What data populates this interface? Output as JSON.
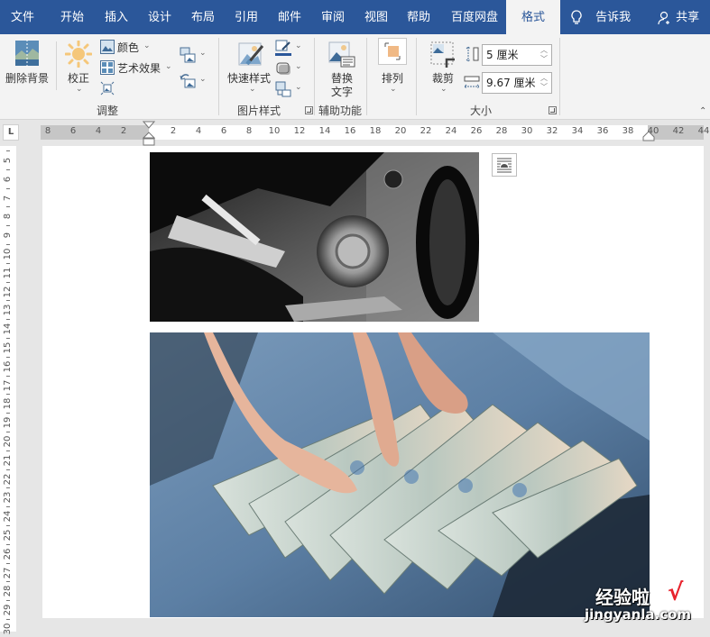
{
  "tabs": [
    {
      "label": "文件"
    },
    {
      "label": "开始"
    },
    {
      "label": "插入"
    },
    {
      "label": "设计"
    },
    {
      "label": "布局"
    },
    {
      "label": "引用"
    },
    {
      "label": "邮件"
    },
    {
      "label": "审阅"
    },
    {
      "label": "视图"
    },
    {
      "label": "帮助"
    },
    {
      "label": "百度网盘"
    },
    {
      "label": "格式",
      "active": true
    }
  ],
  "tell_me": "告诉我",
  "share": "共享",
  "ribbon": {
    "adjust": {
      "remove_bg": "删除背景",
      "corrections": "校正",
      "color": "颜色",
      "artistic": "艺术效果",
      "group_label": "调整"
    },
    "picture_styles": {
      "quick_styles": "快速样式",
      "group_label": "图片样式"
    },
    "accessibility": {
      "alt_text_line1": "替换",
      "alt_text_line2": "文字",
      "group_label": "辅助功能"
    },
    "arrange": {
      "label": "排列"
    },
    "size": {
      "crop": "裁剪",
      "height_value": "5 厘米",
      "width_value": "9.67 厘米",
      "group_label": "大小"
    }
  },
  "ruler": {
    "tab_selector": "L",
    "h_left": [
      "8",
      "6",
      "4",
      "2"
    ],
    "h_right": [
      "2",
      "4",
      "6",
      "8",
      "10",
      "12",
      "14",
      "16",
      "18",
      "20",
      "22",
      "24",
      "26",
      "28",
      "30",
      "32",
      "34",
      "36",
      "38",
      "40",
      "42",
      "44"
    ],
    "v": [
      "5",
      "6",
      "7",
      "8",
      "9",
      "10",
      "11",
      "12",
      "13",
      "14",
      "15",
      "16",
      "17",
      "18",
      "19",
      "20",
      "21",
      "22",
      "23",
      "24",
      "25",
      "26",
      "27",
      "28",
      "29",
      "30"
    ]
  },
  "document": {
    "images": [
      {
        "description": "Black and white close-up of motorcycle engine"
      },
      {
        "description": "Hands fanning US hundred-dollar bills over jeans"
      }
    ]
  },
  "watermark": {
    "line1": "经验啦",
    "check": "√",
    "line2": "jingyanla.com"
  },
  "colors": {
    "accent": "#2b579a",
    "ribbon_bg": "#f3f3f3",
    "watermark_check": "#e8232d"
  }
}
